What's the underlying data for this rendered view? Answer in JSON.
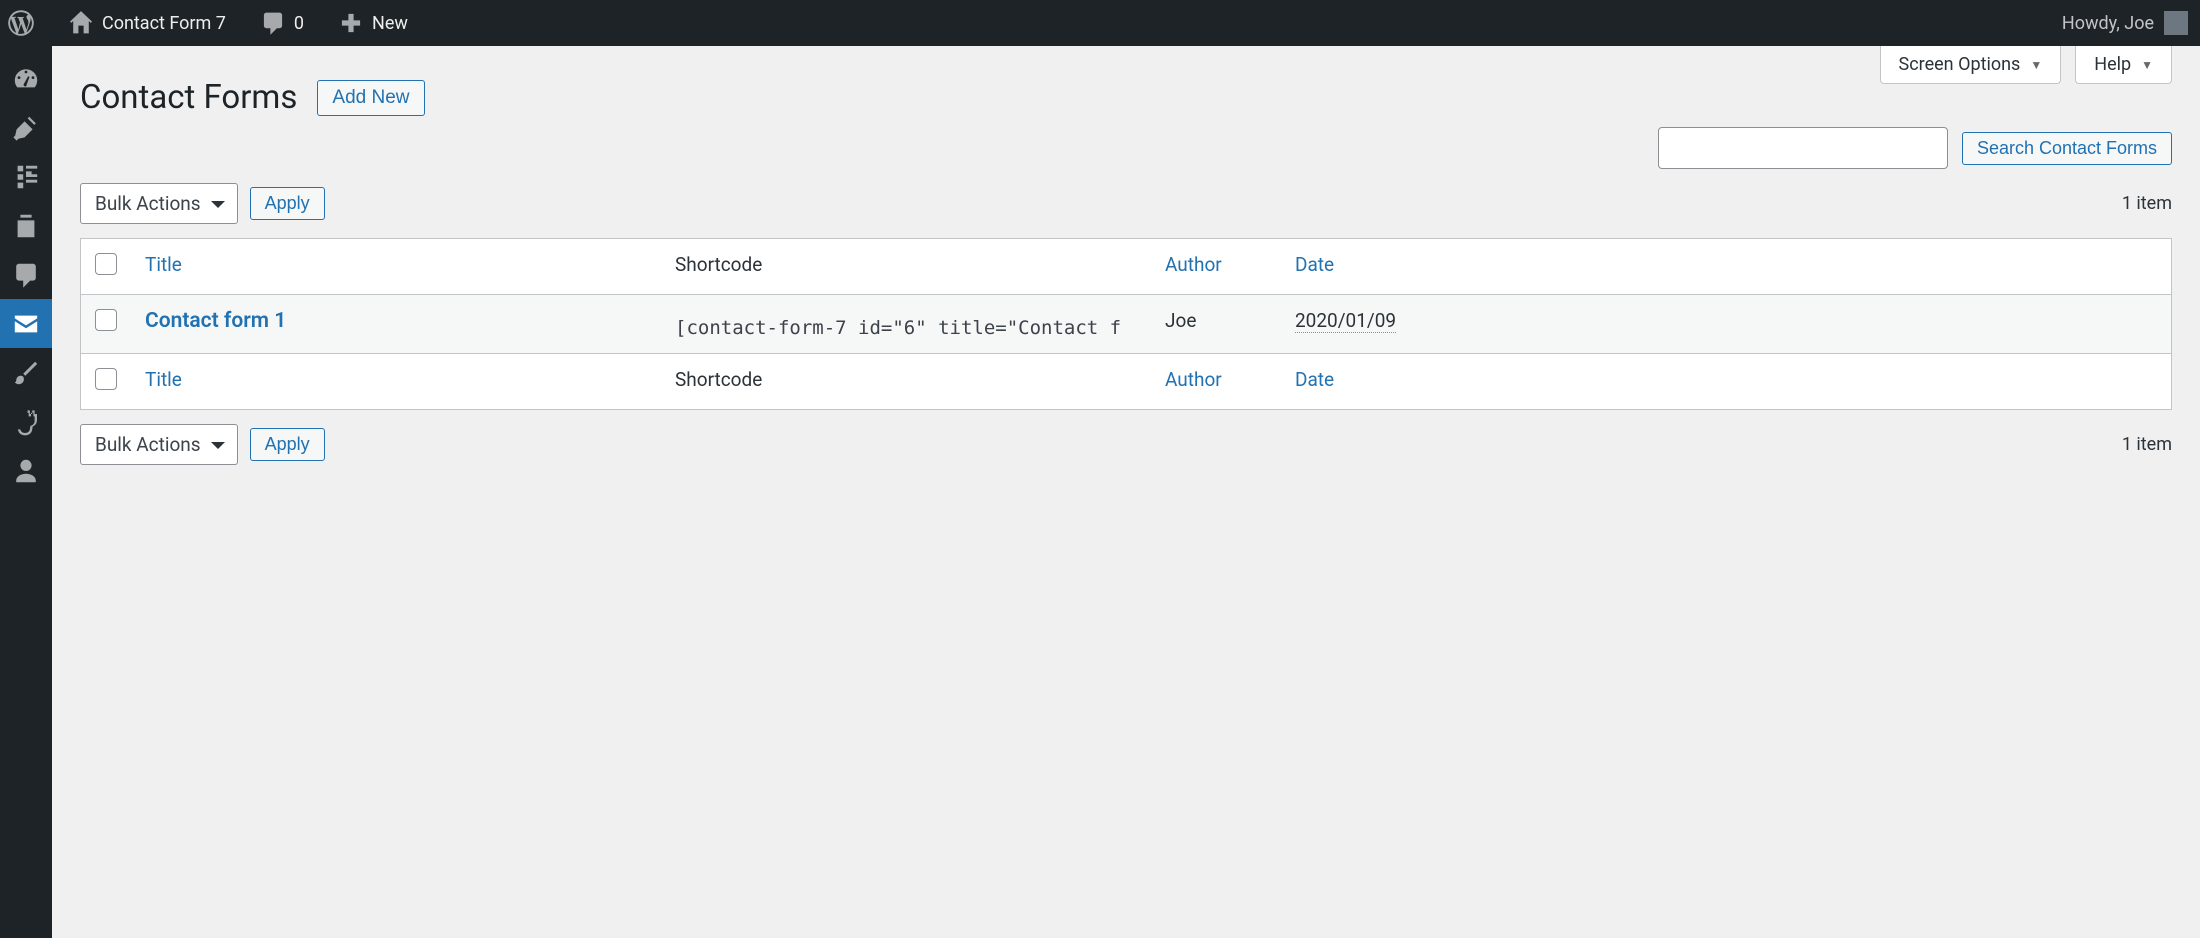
{
  "adminbar": {
    "site_name": "Contact Form 7",
    "comment_count": "0",
    "new_label": "New",
    "greeting": "Howdy, Joe"
  },
  "top_tabs": {
    "screen_options": "Screen Options",
    "help": "Help"
  },
  "page": {
    "title": "Contact Forms",
    "add_new": "Add New",
    "search_button": "Search Contact Forms",
    "bulk_actions": "Bulk Actions",
    "apply": "Apply",
    "item_count": "1 item"
  },
  "table": {
    "columns": {
      "title": "Title",
      "shortcode": "Shortcode",
      "author": "Author",
      "date": "Date"
    },
    "rows": [
      {
        "title": "Contact form 1",
        "shortcode": "[contact-form-7 id=\"6\" title=\"Contact f",
        "author": "Joe",
        "date": "2020/01/09"
      }
    ]
  }
}
